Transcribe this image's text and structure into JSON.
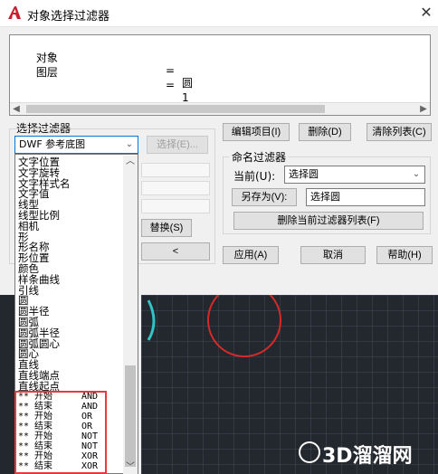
{
  "window": {
    "title": "对象选择过滤器",
    "close_glyph": "✕"
  },
  "filter_list": {
    "rows": [
      {
        "name": "对象",
        "op": "=",
        "value": "圆"
      },
      {
        "name": "图层",
        "op": "=",
        "value": "1"
      }
    ]
  },
  "select_filter": {
    "group_label": "选择过滤器",
    "current_value": "DWF 参考底图",
    "select_button": "选择(E)..."
  },
  "buttons": {
    "edit_item": "编辑项目(I)",
    "delete": "删除(D)",
    "clear_list": "清除列表(C)",
    "replace": "替换(S)",
    "add_arrow": "<",
    "apply": "应用(A)",
    "cancel": "取消",
    "help": "帮助(H)"
  },
  "named_filters": {
    "group_label": "命名过滤器",
    "current_label": "当前(U):",
    "current_value": "选择圆",
    "save_as_button": "另存为(V):",
    "save_as_value": "选择圆",
    "delete_current_button": "删除当前过滤器列表(F)"
  },
  "dropdown": {
    "items": [
      "文字位置",
      "文字旋转",
      "文字样式名",
      "文字值",
      "线型",
      "线型比例",
      "相机",
      "形",
      "形名称",
      "形位置",
      "颜色",
      "样条曲线",
      "引线",
      "圆",
      "圆半径",
      "圆弧",
      "圆弧半径",
      "圆弧圆心",
      "圆心",
      "直线",
      "直线端点",
      "直线起点"
    ],
    "operators": [
      {
        "label": "** 开始",
        "op": "AND"
      },
      {
        "label": "** 结束",
        "op": "AND"
      },
      {
        "label": "** 开始",
        "op": "OR"
      },
      {
        "label": "** 结束",
        "op": "OR"
      },
      {
        "label": "** 开始",
        "op": "NOT"
      },
      {
        "label": "** 结束",
        "op": "NOT"
      },
      {
        "label": "** 开始",
        "op": "XOR"
      },
      {
        "label": "** 结束",
        "op": "XOR"
      }
    ]
  },
  "watermark": "3D溜溜网",
  "colors": {
    "highlight_red": "#e53b3b",
    "cad_background": "#23272e",
    "cad_circle": "#d42a2a",
    "cad_arc": "#2fc5c5"
  }
}
